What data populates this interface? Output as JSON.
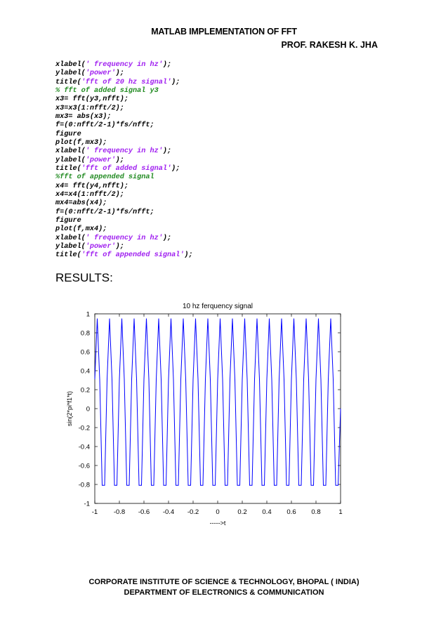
{
  "header": {
    "title": "MATLAB IMPLEMENTATION OF FFT",
    "author": "PROF. RAKESH K. JHA"
  },
  "code_lines": [
    [
      {
        "t": "xlabel(",
        "c": "kw"
      },
      {
        "t": "' frequency in hz'",
        "c": "str"
      },
      {
        "t": ");",
        "c": "kw"
      }
    ],
    [
      {
        "t": "ylabel(",
        "c": "kw"
      },
      {
        "t": "'power'",
        "c": "str"
      },
      {
        "t": ");",
        "c": "kw"
      }
    ],
    [
      {
        "t": "title(",
        "c": "kw"
      },
      {
        "t": "'fft of 20 hz signal'",
        "c": "str"
      },
      {
        "t": ");",
        "c": "kw"
      }
    ],
    [
      {
        "t": "% fft of added signal y3",
        "c": "cmt"
      }
    ],
    [
      {
        "t": "x3= fft(y3,nfft);",
        "c": "kw"
      }
    ],
    [
      {
        "t": "x3=x3(1:nfft/2);",
        "c": "kw"
      }
    ],
    [
      {
        "t": "mx3= abs(x3);",
        "c": "kw"
      }
    ],
    [
      {
        "t": "f=(0:nfft/2-1)*fs/nfft;",
        "c": "kw"
      }
    ],
    [
      {
        "t": "figure",
        "c": "kw"
      }
    ],
    [
      {
        "t": "plot(f,mx3);",
        "c": "kw"
      }
    ],
    [
      {
        "t": "xlabel(",
        "c": "kw"
      },
      {
        "t": "' frequency in hz'",
        "c": "str"
      },
      {
        "t": ");",
        "c": "kw"
      }
    ],
    [
      {
        "t": "ylabel(",
        "c": "kw"
      },
      {
        "t": "'power'",
        "c": "str"
      },
      {
        "t": ");",
        "c": "kw"
      }
    ],
    [
      {
        "t": "title(",
        "c": "kw"
      },
      {
        "t": "'fft of added signal'",
        "c": "str"
      },
      {
        "t": ");",
        "c": "kw"
      }
    ],
    [
      {
        "t": "%fft of appended signal",
        "c": "cmt"
      }
    ],
    [
      {
        "t": "x4= fft(y4,nfft);",
        "c": "kw"
      }
    ],
    [
      {
        "t": "x4=x4(1:nfft/2);",
        "c": "kw"
      }
    ],
    [
      {
        "t": "mx4=abs(x4);",
        "c": "kw"
      }
    ],
    [
      {
        "t": "f=(0:nfft/2-1)*fs/nfft;",
        "c": "kw"
      }
    ],
    [
      {
        "t": "figure",
        "c": "kw"
      }
    ],
    [
      {
        "t": "plot(f,mx4);",
        "c": "kw"
      }
    ],
    [
      {
        "t": "xlabel(",
        "c": "kw"
      },
      {
        "t": "' frequency in hz'",
        "c": "str"
      },
      {
        "t": ");",
        "c": "kw"
      }
    ],
    [
      {
        "t": "ylabel(",
        "c": "kw"
      },
      {
        "t": "'power'",
        "c": "str"
      },
      {
        "t": ");",
        "c": "kw"
      }
    ],
    [
      {
        "t": "title(",
        "c": "kw"
      },
      {
        "t": "'fft of appended signal'",
        "c": "str"
      },
      {
        "t": ");",
        "c": "kw"
      }
    ]
  ],
  "results_heading": "RESULTS:",
  "chart_data": {
    "type": "line",
    "title": "10 hz ferquency signal",
    "xlabel": "----->t",
    "ylabel": "sin(2*pi*f1*t)",
    "xlim": [
      -1,
      1
    ],
    "ylim": [
      -1,
      1
    ],
    "xticks": [
      "-1",
      "-0.8",
      "-0.6",
      "-0.4",
      "-0.2",
      "0",
      "0.2",
      "0.4",
      "0.6",
      "0.8",
      "1"
    ],
    "yticks": [
      "-1",
      "-0.8",
      "-0.6",
      "-0.4",
      "-0.2",
      "0",
      "0.2",
      "0.4",
      "0.6",
      "0.8",
      "1"
    ],
    "grid": false,
    "line_color": "#0000ff",
    "series": [
      {
        "frequency_hz": 10,
        "sample_step": 0.02,
        "x_start": -1,
        "x_end": 1,
        "amplitude": 0.951
      }
    ]
  },
  "footer": {
    "line1": "CORPORATE INSTITUTE OF SCIENCE & TECHNOLOGY, BHOPAL ( INDIA)",
    "line2": "DEPARTMENT OF ELECTRONICS & COMMUNICATION"
  }
}
